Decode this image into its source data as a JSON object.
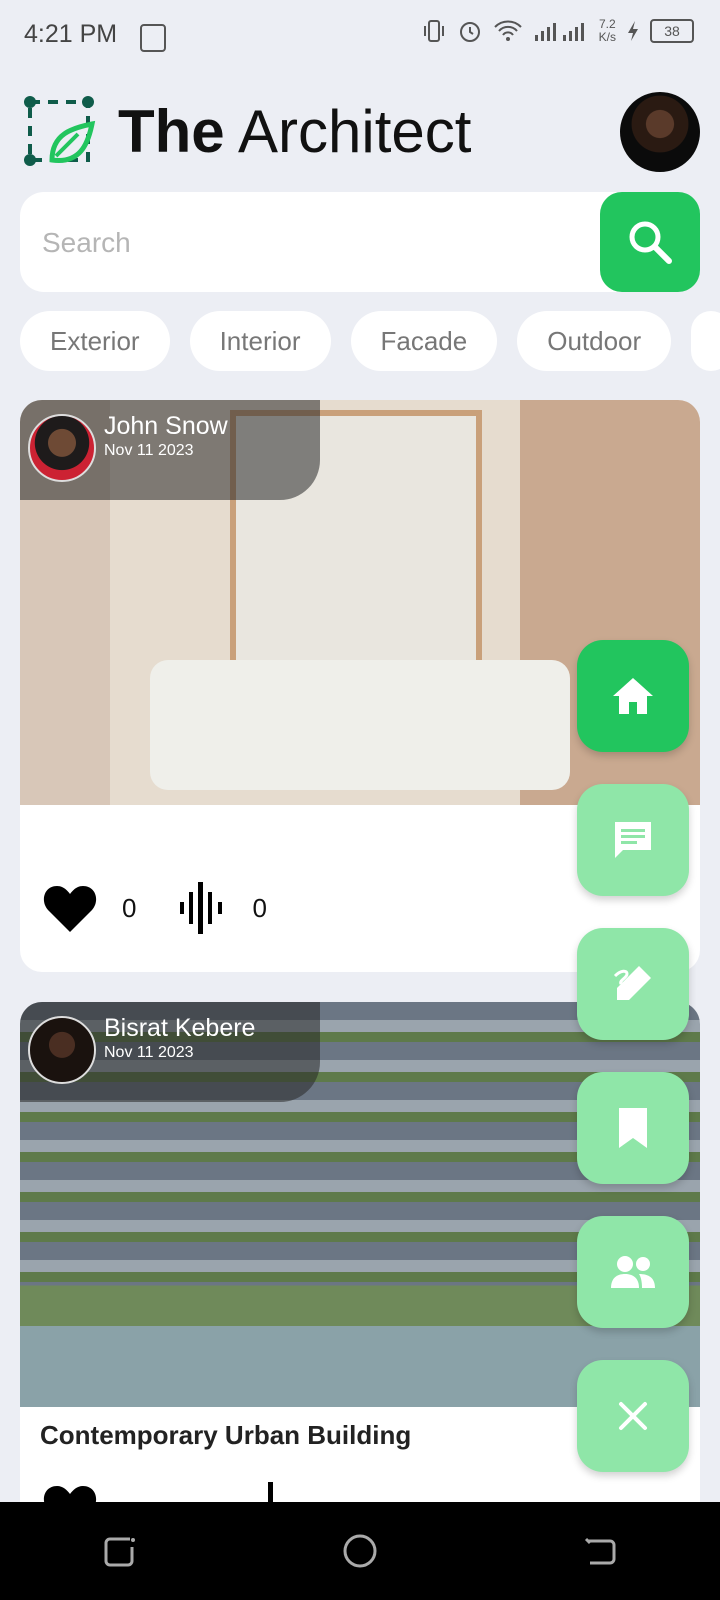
{
  "status_bar": {
    "time": "4:21 PM",
    "speed_value": "7.2",
    "speed_unit": "K/s",
    "battery": "38",
    "icons": [
      "vibrate-icon",
      "alarm-icon",
      "wifi-icon",
      "signal-icon",
      "charging-icon"
    ]
  },
  "header": {
    "title_bold": "The",
    "title_light": "Architect"
  },
  "search": {
    "placeholder": "Search",
    "value": ""
  },
  "categories": [
    "Exterior",
    "Interior",
    "Facade",
    "Outdoor"
  ],
  "posts": [
    {
      "author": "John Snow",
      "date": "Nov 11 2023",
      "title": "",
      "likes": "0",
      "listens": "0"
    },
    {
      "author": "Bisrat Kebere",
      "date": "Nov 11 2023",
      "title": "Contemporary Urban Building"
    }
  ],
  "fab_menu": [
    "home-icon",
    "chat-icon",
    "edit-icon",
    "bookmark-icon",
    "people-icon",
    "close-icon"
  ],
  "colors": {
    "accent": "#22c55e",
    "accent_light": "#8fe6a8",
    "background": "#eceef4"
  }
}
